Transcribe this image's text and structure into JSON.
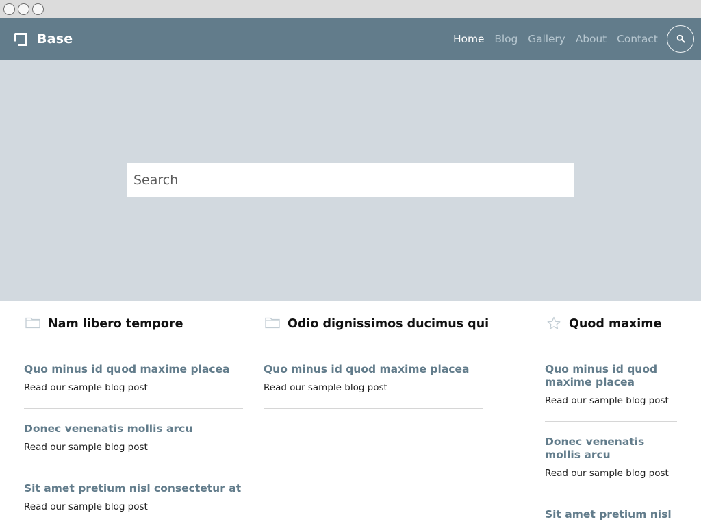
{
  "header": {
    "brand": "Base",
    "nav": [
      {
        "label": "Home",
        "active": true
      },
      {
        "label": "Blog",
        "active": false
      },
      {
        "label": "Gallery",
        "active": false
      },
      {
        "label": "About",
        "active": false
      },
      {
        "label": "Contact",
        "active": false
      }
    ],
    "search_icon": "search-icon"
  },
  "hero": {
    "search_placeholder": "Search"
  },
  "columns": [
    {
      "icon": "folder-icon",
      "title": "Nam libero tempore",
      "posts": [
        {
          "title": "Quo minus id quod maxime placea",
          "excerpt": "Read our sample blog post"
        },
        {
          "title": "Donec venenatis mollis arcu",
          "excerpt": "Read our sample blog post"
        },
        {
          "title": "Sit amet pretium nisl consectetur at",
          "excerpt": "Read our sample blog post"
        }
      ]
    },
    {
      "icon": "folder-icon",
      "title": "Odio dignissimos ducimus qui",
      "posts": [
        {
          "title": "Quo minus id quod maxime placea",
          "excerpt": "Read our sample blog post"
        }
      ]
    },
    {
      "icon": "star-icon",
      "title": "Quod maxime",
      "posts": [
        {
          "title": "Quo minus id quod maxime placea",
          "excerpt": "Read our sample blog post"
        },
        {
          "title": "Donec venenatis mollis arcu",
          "excerpt": "Read our sample blog post"
        },
        {
          "title": "Sit amet pretium nisl",
          "excerpt": ""
        }
      ]
    }
  ],
  "colors": {
    "header_bg": "#627c8b",
    "hero_bg": "#d2d9df",
    "link": "#627c8b",
    "nav_inactive": "#b7c7d0"
  }
}
